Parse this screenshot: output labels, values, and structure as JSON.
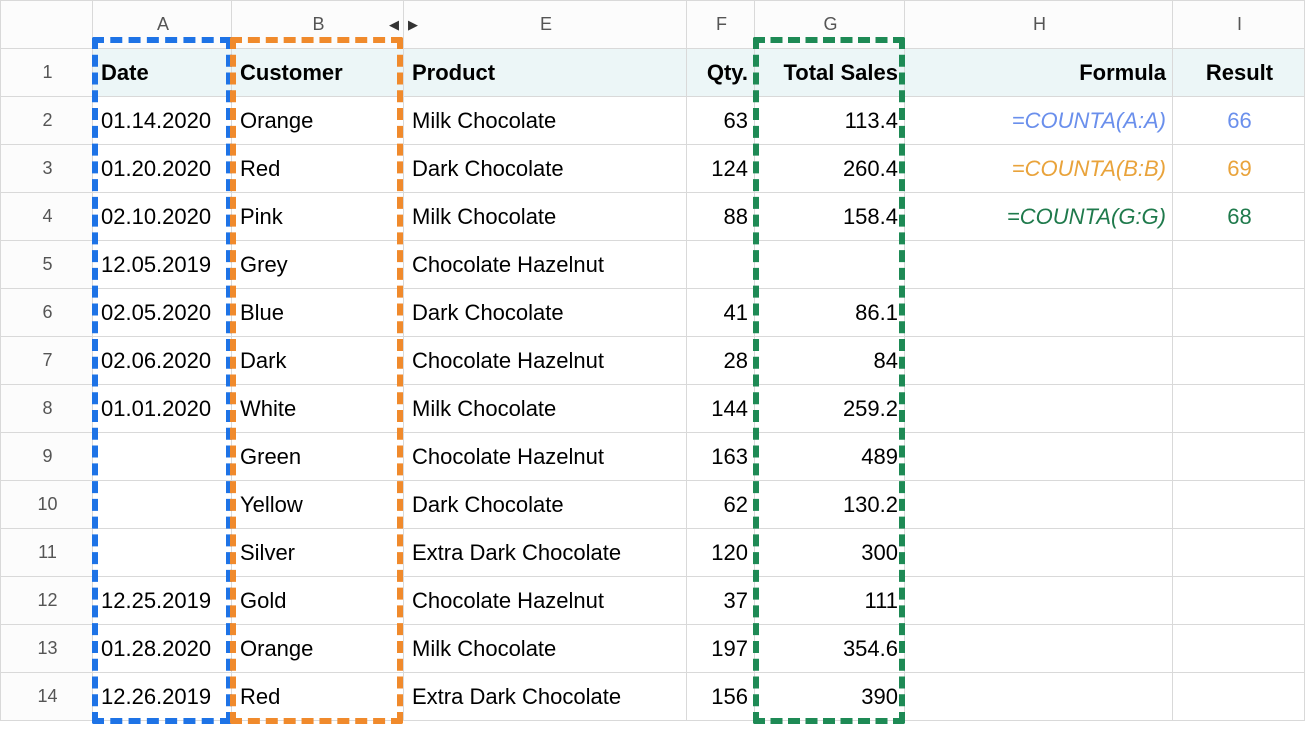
{
  "colLetters": [
    "A",
    "B",
    "E",
    "F",
    "G",
    "H",
    "I"
  ],
  "rowNums": [
    "1",
    "2",
    "3",
    "4",
    "5",
    "6",
    "7",
    "8",
    "9",
    "10",
    "11",
    "12",
    "13",
    "14"
  ],
  "headers": {
    "A": "Date",
    "B": "Customer",
    "E": "Product",
    "F": "Qty.",
    "G": "Total Sales",
    "H": "Formula",
    "I": "Result"
  },
  "rows": [
    {
      "A": "01.14.2020",
      "B": "Orange",
      "E": "Milk Chocolate",
      "F": "63",
      "G": "113.4",
      "H": "=COUNTA(A:A)",
      "I": "66"
    },
    {
      "A": "01.20.2020",
      "B": "Red",
      "E": "Dark Chocolate",
      "F": "124",
      "G": "260.4",
      "H": "=COUNTA(B:B)",
      "I": "69"
    },
    {
      "A": "02.10.2020",
      "B": "Pink",
      "E": "Milk Chocolate",
      "F": "88",
      "G": "158.4",
      "H": "=COUNTA(G:G)",
      "I": "68"
    },
    {
      "A": "12.05.2019",
      "B": "Grey",
      "E": "Chocolate Hazelnut",
      "F": "",
      "G": "",
      "H": "",
      "I": ""
    },
    {
      "A": "02.05.2020",
      "B": "Blue",
      "E": "Dark Chocolate",
      "F": "41",
      "G": "86.1",
      "H": "",
      "I": ""
    },
    {
      "A": "02.06.2020",
      "B": "Dark",
      "E": "Chocolate Hazelnut",
      "F": "28",
      "G": "84",
      "H": "",
      "I": ""
    },
    {
      "A": "01.01.2020",
      "B": "White",
      "E": "Milk Chocolate",
      "F": "144",
      "G": "259.2",
      "H": "",
      "I": ""
    },
    {
      "A": "",
      "B": "Green",
      "E": "Chocolate Hazelnut",
      "F": "163",
      "G": "489",
      "H": "",
      "I": ""
    },
    {
      "A": "",
      "B": "Yellow",
      "E": "Dark Chocolate",
      "F": "62",
      "G": "130.2",
      "H": "",
      "I": ""
    },
    {
      "A": "",
      "B": "Silver",
      "E": "Extra Dark Chocolate",
      "F": "120",
      "G": "300",
      "H": "",
      "I": ""
    },
    {
      "A": "12.25.2019",
      "B": "Gold",
      "E": "Chocolate Hazelnut",
      "F": "37",
      "G": "111",
      "H": "",
      "I": ""
    },
    {
      "A": "01.28.2020",
      "B": "Orange",
      "E": "Milk Chocolate",
      "F": "197",
      "G": "354.6",
      "H": "",
      "I": ""
    },
    {
      "A": "12.26.2019",
      "B": "Red",
      "E": "Extra Dark Chocolate",
      "F": "156",
      "G": "390",
      "H": "",
      "I": ""
    }
  ],
  "formulaColors": [
    "blue",
    "orange",
    "green"
  ]
}
